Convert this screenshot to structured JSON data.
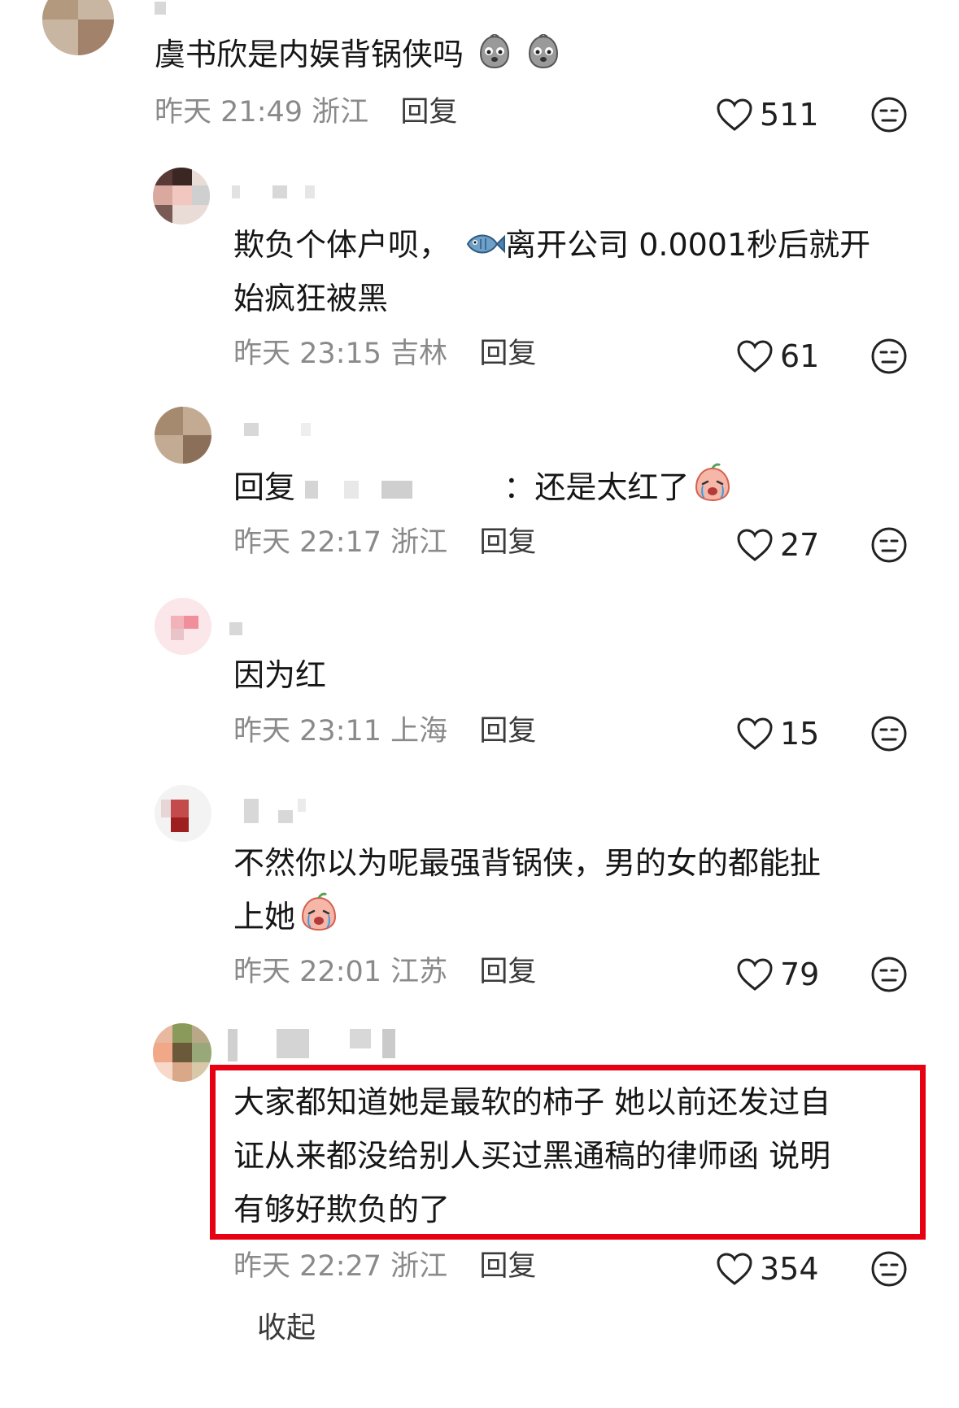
{
  "comments": [
    {
      "text": "虞书欣是内娱背锅侠吗",
      "emojis": [
        "crying-blob-emoji",
        "crying-blob-emoji"
      ],
      "date": "昨天",
      "time": "21:49",
      "location": "浙江",
      "reply_label": "回复",
      "likes": "511"
    },
    {
      "text_part1": "欺负个体户呗，",
      "text_part2": "离开公司 0.0001秒后就开",
      "text_line2": "始疯狂被黑",
      "emojis": [
        "fish-emoji"
      ],
      "date": "昨天",
      "time": "23:15",
      "location": "吉林",
      "reply_label": "回复",
      "likes": "61"
    },
    {
      "reply_prefix": "回复",
      "text": "：还是太红了",
      "emojis": [
        "crying-peach-emoji"
      ],
      "date": "昨天",
      "time": "22:17",
      "location": "浙江",
      "reply_label": "回复",
      "likes": "27"
    },
    {
      "text": "因为红",
      "date": "昨天",
      "time": "23:11",
      "location": "上海",
      "reply_label": "回复",
      "likes": "15"
    },
    {
      "text_line1": "不然你以为呢最强背锅侠，男的女的都能扯",
      "text_line2": "上她",
      "emojis": [
        "crying-peach-emoji"
      ],
      "date": "昨天",
      "time": "22:01",
      "location": "江苏",
      "reply_label": "回复",
      "likes": "79"
    },
    {
      "text_line1": "大家都知道她是最软的柿子 她以前还发过自",
      "text_line2": "证从来都没给别人买过黑通稿的律师函 说明",
      "text_line3": "有够好欺负的了",
      "date": "昨天",
      "time": "22:27",
      "location": "浙江",
      "reply_label": "回复",
      "likes": "354"
    }
  ],
  "collapse_label": "收起",
  "colors": {
    "highlight": "#e60012",
    "meta_text": "#8a8a8a",
    "body_text": "#161616"
  },
  "icons": {
    "like": "heart-outline-icon",
    "dislike": "meh-face-icon"
  }
}
